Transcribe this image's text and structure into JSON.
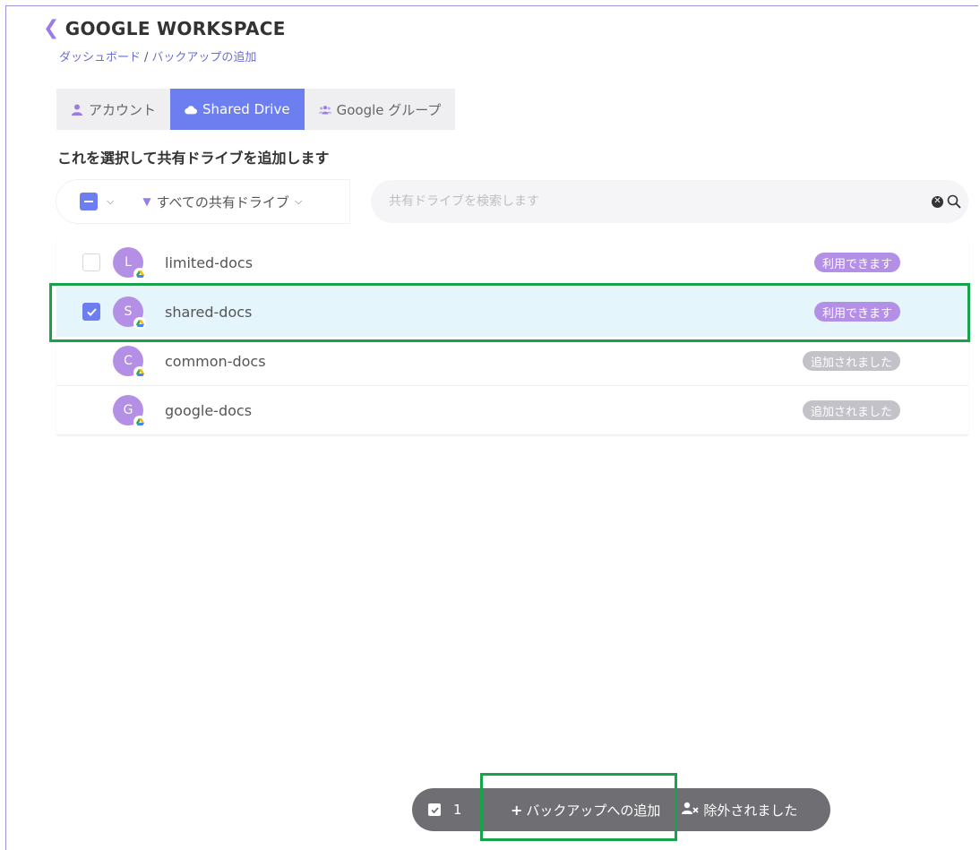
{
  "header": {
    "title": "GOOGLE WORKSPACE",
    "breadcrumb": [
      {
        "label": "ダッシュボード"
      },
      {
        "label": "バックアップの追加"
      }
    ],
    "breadcrumb_sep": "/"
  },
  "tabs": [
    {
      "label": "アカウント",
      "icon": "user-icon",
      "active": false
    },
    {
      "label": "Shared Drive",
      "icon": "cloud-icon",
      "active": true
    },
    {
      "label": "Google グループ",
      "icon": "group-icon",
      "active": false
    }
  ],
  "section_title": "これを選択して共有ドライブを追加します",
  "toolbar": {
    "filter_label": "すべての共有ドライブ",
    "search_placeholder": "共有ドライブを検索します"
  },
  "drives": [
    {
      "initial": "L",
      "name": "limited-docs",
      "status": "利用できます",
      "status_type": "available",
      "checked": false,
      "has_checkbox": true
    },
    {
      "initial": "S",
      "name": "shared-docs",
      "status": "利用できます",
      "status_type": "available",
      "checked": true,
      "has_checkbox": true
    },
    {
      "initial": "C",
      "name": "common-docs",
      "status": "追加されました",
      "status_type": "added",
      "checked": false,
      "has_checkbox": false
    },
    {
      "initial": "G",
      "name": "google-docs",
      "status": "追加されました",
      "status_type": "added",
      "checked": false,
      "has_checkbox": false
    }
  ],
  "action_bar": {
    "selected_count": "1",
    "add_label": "バックアップへの追加",
    "excluded_label": "除外されました"
  },
  "colors": {
    "accent": "#6d7ef0",
    "avatar": "#b48fe6",
    "highlight": "#16a34a",
    "action_bar": "#6f6f73"
  }
}
